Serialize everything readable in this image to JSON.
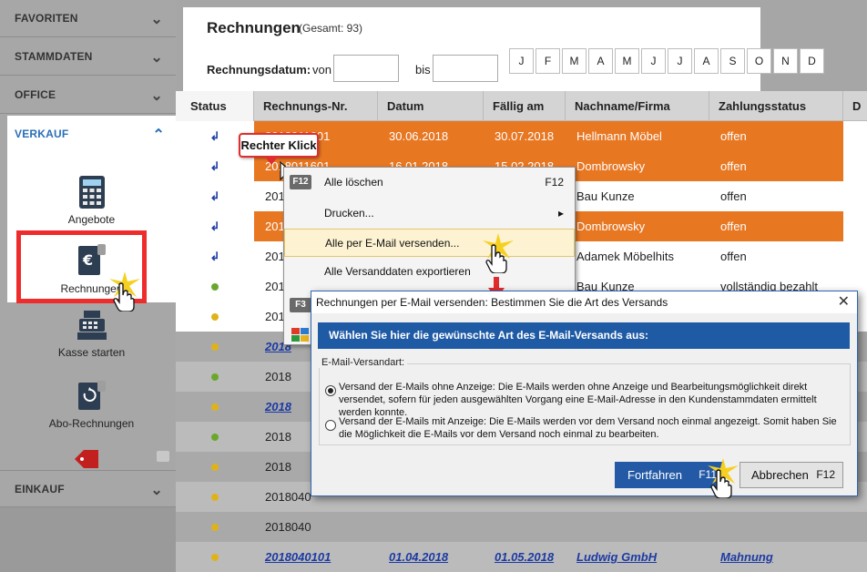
{
  "sidebar": {
    "sections": [
      {
        "label": "FAVORITEN"
      },
      {
        "label": "STAMMDATEN"
      },
      {
        "label": "OFFICE"
      },
      {
        "label": "VERKAUF"
      },
      {
        "label": "EINKAUF"
      }
    ],
    "items": [
      {
        "label": "Angebote",
        "icon": "calculator-icon"
      },
      {
        "label": "Rechnungen",
        "icon": "invoice-euro-icon"
      },
      {
        "label": "Kasse starten",
        "icon": "cash-register-icon"
      },
      {
        "label": "Abo-Rechnungen",
        "icon": "subscription-invoice-icon"
      }
    ]
  },
  "header": {
    "title": "Rechnungen",
    "total": "(Gesamt: 93)",
    "date_label": "Rechnungsdatum:",
    "from_label": "von",
    "to_label": "bis",
    "months": [
      "J",
      "F",
      "M",
      "A",
      "M",
      "J",
      "J",
      "A",
      "S",
      "O",
      "N",
      "D"
    ]
  },
  "table": {
    "columns": [
      "Status",
      "Rechnungs-Nr.",
      "Datum",
      "Fällig am",
      "Nachname/Firma",
      "Zahlungsstatus",
      "D"
    ],
    "rows": [
      {
        "nr": "2018011601",
        "datum": "30.06.2018",
        "faellig": "30.07.2018",
        "name": "Hellmann Möbel",
        "zahlung": "offen"
      },
      {
        "nr": "2018011601",
        "datum": "16.01.2018",
        "faellig": "15.02.2018",
        "name": "Dombrowsky",
        "zahlung": "offen"
      },
      {
        "nr": "2018",
        "datum": "",
        "faellig": "",
        "name": "Bau Kunze",
        "zahlung": "offen"
      },
      {
        "nr": "2018",
        "datum": "",
        "faellig": "",
        "name": "Dombrowsky",
        "zahlung": "offen"
      },
      {
        "nr": "2018",
        "datum": "",
        "faellig": "",
        "name": "Adamek Möbelhits",
        "zahlung": "offen"
      },
      {
        "nr": "2018",
        "datum": "",
        "faellig": "",
        "name": "Bau Kunze",
        "zahlung": "vollständig bezahlt"
      },
      {
        "nr": "2018",
        "datum": "",
        "faellig": "",
        "name": "",
        "zahlung": ""
      },
      {
        "nr": "2018",
        "datum": "",
        "faellig": "",
        "name": "",
        "zahlung": ""
      },
      {
        "nr": "2018",
        "datum": "",
        "faellig": "",
        "name": "",
        "zahlung": ""
      },
      {
        "nr": "2018",
        "datum": "",
        "faellig": "",
        "name": "",
        "zahlung": ""
      },
      {
        "nr": "2018",
        "datum": "",
        "faellig": "",
        "name": "",
        "zahlung": ""
      },
      {
        "nr": "2018",
        "datum": "",
        "faellig": "",
        "name": "",
        "zahlung": ""
      },
      {
        "nr": "2018040",
        "datum": "",
        "faellig": "",
        "name": "",
        "zahlung": ""
      },
      {
        "nr": "2018040",
        "datum": "",
        "faellig": "",
        "name": "",
        "zahlung": ""
      },
      {
        "nr": "2018040101",
        "datum": "01.04.2018",
        "faellig": "01.05.2018",
        "name": "Ludwig GmbH",
        "zahlung": "Mahnung"
      }
    ]
  },
  "callout": {
    "text": "Rechter Klick"
  },
  "context_menu": {
    "items": [
      {
        "label": "Alle löschen",
        "shortcut": "F12",
        "badge": "F12"
      },
      {
        "label": "Drucken...",
        "shortcut": "▸"
      },
      {
        "label": "Alle per E-Mail versenden..."
      },
      {
        "label": "Alle Versanddaten exportieren"
      }
    ],
    "badge_f3": "F3"
  },
  "dialog": {
    "title": "Rechnungen per E-Mail versenden: Bestimmen Sie die Art des Versands",
    "banner": "Wählen Sie hier die gewünschte Art des E-Mail-Versands aus:",
    "group_label": "E-Mail-Versandart:",
    "option1": "Versand der E-Mails ohne Anzeige: Die E-Mails werden ohne Anzeige und Bearbeitungsmöglichkeit direkt versendet, sofern für jeden ausgewählten Vorgang eine E-Mail-Adresse in den Kundenstammdaten ermittelt werden konnte.",
    "option2": "Versand der E-Mails mit Anzeige: Die E-Mails werden vor dem Versand noch einmal angezeigt. Somit haben Sie die Möglichkeit die E-Mails vor dem Versand noch einmal zu bearbeiten.",
    "continue_label": "Fortfahren",
    "continue_shortcut": "F11",
    "cancel_label": "Abbrechen",
    "cancel_shortcut": "F12"
  },
  "colors": {
    "orange_row": "#e87722",
    "accent_blue": "#1f5aa5",
    "highlight_red": "#ee2c2c"
  }
}
